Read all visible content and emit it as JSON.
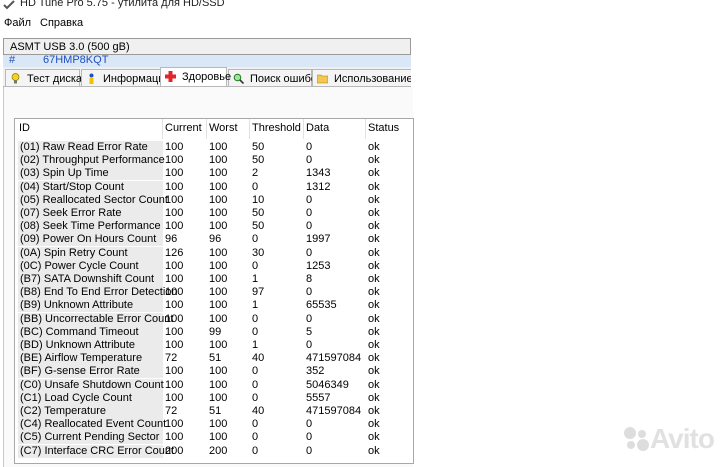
{
  "window": {
    "title": "HD Tune Pro 5.75 - утилита для HD/SSD"
  },
  "menu": [
    {
      "label": "Файл"
    },
    {
      "label": "Справка"
    }
  ],
  "drive": {
    "label": "ASMT   USB 3.0 (500 gB)"
  },
  "serial": {
    "hash": "#",
    "value": "67HMP8KQT"
  },
  "tabs": [
    {
      "label": "Тест диска",
      "icon": "lightbulb-icon"
    },
    {
      "label": "Информация",
      "icon": "person-info-icon"
    },
    {
      "label": "Здоровье",
      "icon": "red-cross-icon",
      "active": true
    },
    {
      "label": "Поиск ошибок",
      "icon": "magnifier-icon"
    },
    {
      "label": "Использование па",
      "icon": "folder-icon"
    }
  ],
  "table": {
    "columns": [
      "ID",
      "Current",
      "Worst",
      "Threshold",
      "Data",
      "Status"
    ],
    "rows": [
      [
        "(01) Raw Read Error Rate",
        "100",
        "100",
        "50",
        "0",
        "ok"
      ],
      [
        "(02) Throughput Performance",
        "100",
        "100",
        "50",
        "0",
        "ok"
      ],
      [
        "(03) Spin Up Time",
        "100",
        "100",
        "2",
        "1343",
        "ok"
      ],
      [
        "(04) Start/Stop Count",
        "100",
        "100",
        "0",
        "1312",
        "ok"
      ],
      [
        "(05) Reallocated Sector Count",
        "100",
        "100",
        "10",
        "0",
        "ok"
      ],
      [
        "(07) Seek Error Rate",
        "100",
        "100",
        "50",
        "0",
        "ok"
      ],
      [
        "(08) Seek Time Performance",
        "100",
        "100",
        "50",
        "0",
        "ok"
      ],
      [
        "(09) Power On Hours Count",
        "96",
        "96",
        "0",
        "1997",
        "ok"
      ],
      [
        "(0A) Spin Retry Count",
        "126",
        "100",
        "30",
        "0",
        "ok"
      ],
      [
        "(0C) Power Cycle Count",
        "100",
        "100",
        "0",
        "1253",
        "ok"
      ],
      [
        "(B7) SATA Downshift Count",
        "100",
        "100",
        "1",
        "8",
        "ok"
      ],
      [
        "(B8) End To End Error Detection",
        "100",
        "100",
        "97",
        "0",
        "ok"
      ],
      [
        "(B9) Unknown Attribute",
        "100",
        "100",
        "1",
        "65535",
        "ok"
      ],
      [
        "(BB) Uncorrectable Error Count",
        "100",
        "100",
        "0",
        "0",
        "ok"
      ],
      [
        "(BC) Command Timeout",
        "100",
        "99",
        "0",
        "5",
        "ok"
      ],
      [
        "(BD) Unknown Attribute",
        "100",
        "100",
        "1",
        "0",
        "ok"
      ],
      [
        "(BE) Airflow Temperature",
        "72",
        "51",
        "40",
        "471597084",
        "ok"
      ],
      [
        "(BF) G-sense Error Rate",
        "100",
        "100",
        "0",
        "352",
        "ok"
      ],
      [
        "(C0) Unsafe Shutdown Count",
        "100",
        "100",
        "0",
        "5046349",
        "ok"
      ],
      [
        "(C1) Load Cycle Count",
        "100",
        "100",
        "0",
        "5557",
        "ok"
      ],
      [
        "(C2) Temperature",
        "72",
        "51",
        "40",
        "471597084",
        "ok"
      ],
      [
        "(C4) Reallocated Event Count",
        "100",
        "100",
        "0",
        "0",
        "ok"
      ],
      [
        "(C5) Current Pending Sector",
        "100",
        "100",
        "0",
        "0",
        "ok"
      ],
      [
        "(C7) Interface CRC Error Count",
        "200",
        "200",
        "0",
        "0",
        "ok"
      ]
    ]
  },
  "watermark": {
    "text": "Avito"
  }
}
